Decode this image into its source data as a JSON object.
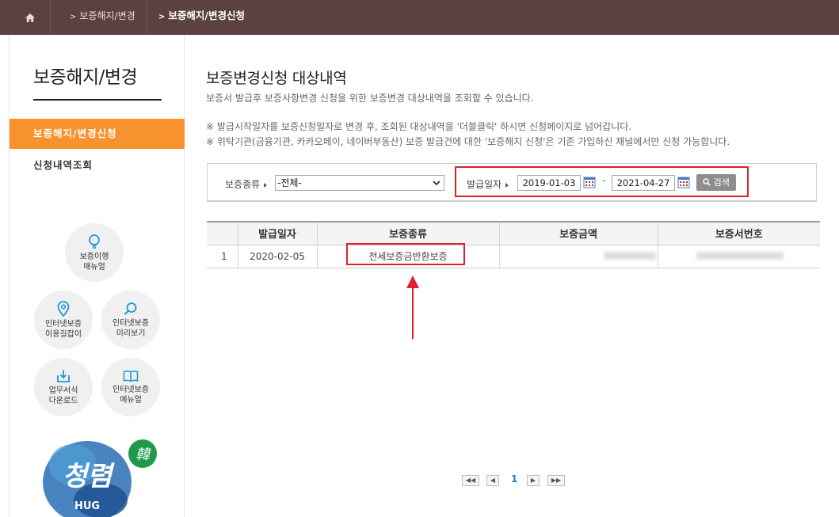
{
  "breadcrumb": {
    "home_icon": "home-icon",
    "item1": "보증해지/변경",
    "item2": "보증해지/변경신청"
  },
  "sidebar": {
    "title": "보증해지/변경",
    "menu_active": "보증해지/변경신청",
    "menu_item": "신청내역조회",
    "circles": [
      {
        "icon": "lightbulb-icon",
        "line1": "보증이행",
        "line2": "매뉴얼"
      },
      {
        "icon": "map-pin-icon",
        "line1": "인터넷보증",
        "line2": "이용길잡이"
      },
      {
        "icon": "magnifier-icon",
        "line1": "인터넷보증",
        "line2": "미리보기"
      },
      {
        "icon": "download-icon",
        "line1": "업무서식",
        "line2": "다운로드"
      },
      {
        "icon": "book-icon",
        "line1": "인터넷보증",
        "line2": "메뉴얼"
      }
    ],
    "logo": {
      "big": "청렴",
      "badge": "韓",
      "sub": "HUG"
    }
  },
  "main": {
    "title": "보증변경신청 대상내역",
    "description": "보증서 발급후 보증사항변경 신청을 위한 보증변경 대상내역을 조회할 수 있습니다.",
    "note1": "※ 발급시작일자를 보증신청일자로 변경 후, 조회된 대상내역을 '더블클릭' 하시면 신청페이지로 넘어갑니다.",
    "note2": "※ 위탁기관(금융기관, 카카오페이, 네이버부동산) 보증 발급건에 대한 '보증해지 신청'은 기존 가입하신 채널에서만 신청 가능합니다."
  },
  "search": {
    "type_label": "보증종류",
    "type_value": "-전체-",
    "date_label": "발급일자",
    "date_from": "2019-01-03",
    "date_to": "2021-04-27",
    "dash": "-",
    "button": "검색"
  },
  "table": {
    "headers": [
      "",
      "발급일자",
      "보증종류",
      "보증금액",
      "보증서번호"
    ],
    "rows": [
      {
        "no": "1",
        "date": "2020-02-05",
        "type": "전세보증금반환보증"
      }
    ]
  },
  "pagination": {
    "first": "◀◀",
    "prev": "◀",
    "current": "1",
    "next": "▶",
    "last": "▶▶"
  },
  "colors": {
    "topbar": "#5b4240",
    "accent": "#f7922e",
    "highlight": "#e0202f",
    "page_link": "#1e7ac7"
  }
}
